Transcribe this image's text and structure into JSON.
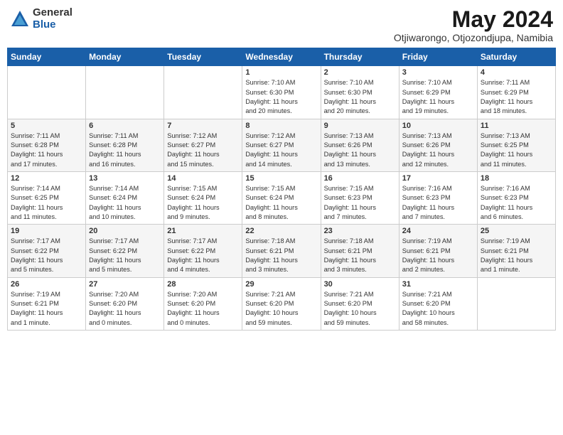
{
  "logo": {
    "general": "General",
    "blue": "Blue"
  },
  "title": {
    "month_year": "May 2024",
    "location": "Otjiwarongo, Otjozondjupa, Namibia"
  },
  "days_header": [
    "Sunday",
    "Monday",
    "Tuesday",
    "Wednesday",
    "Thursday",
    "Friday",
    "Saturday"
  ],
  "weeks": [
    [
      {
        "day": "",
        "info": ""
      },
      {
        "day": "",
        "info": ""
      },
      {
        "day": "",
        "info": ""
      },
      {
        "day": "1",
        "info": "Sunrise: 7:10 AM\nSunset: 6:30 PM\nDaylight: 11 hours\nand 20 minutes."
      },
      {
        "day": "2",
        "info": "Sunrise: 7:10 AM\nSunset: 6:30 PM\nDaylight: 11 hours\nand 20 minutes."
      },
      {
        "day": "3",
        "info": "Sunrise: 7:10 AM\nSunset: 6:29 PM\nDaylight: 11 hours\nand 19 minutes."
      },
      {
        "day": "4",
        "info": "Sunrise: 7:11 AM\nSunset: 6:29 PM\nDaylight: 11 hours\nand 18 minutes."
      }
    ],
    [
      {
        "day": "5",
        "info": "Sunrise: 7:11 AM\nSunset: 6:28 PM\nDaylight: 11 hours\nand 17 minutes."
      },
      {
        "day": "6",
        "info": "Sunrise: 7:11 AM\nSunset: 6:28 PM\nDaylight: 11 hours\nand 16 minutes."
      },
      {
        "day": "7",
        "info": "Sunrise: 7:12 AM\nSunset: 6:27 PM\nDaylight: 11 hours\nand 15 minutes."
      },
      {
        "day": "8",
        "info": "Sunrise: 7:12 AM\nSunset: 6:27 PM\nDaylight: 11 hours\nand 14 minutes."
      },
      {
        "day": "9",
        "info": "Sunrise: 7:13 AM\nSunset: 6:26 PM\nDaylight: 11 hours\nand 13 minutes."
      },
      {
        "day": "10",
        "info": "Sunrise: 7:13 AM\nSunset: 6:26 PM\nDaylight: 11 hours\nand 12 minutes."
      },
      {
        "day": "11",
        "info": "Sunrise: 7:13 AM\nSunset: 6:25 PM\nDaylight: 11 hours\nand 11 minutes."
      }
    ],
    [
      {
        "day": "12",
        "info": "Sunrise: 7:14 AM\nSunset: 6:25 PM\nDaylight: 11 hours\nand 11 minutes."
      },
      {
        "day": "13",
        "info": "Sunrise: 7:14 AM\nSunset: 6:24 PM\nDaylight: 11 hours\nand 10 minutes."
      },
      {
        "day": "14",
        "info": "Sunrise: 7:15 AM\nSunset: 6:24 PM\nDaylight: 11 hours\nand 9 minutes."
      },
      {
        "day": "15",
        "info": "Sunrise: 7:15 AM\nSunset: 6:24 PM\nDaylight: 11 hours\nand 8 minutes."
      },
      {
        "day": "16",
        "info": "Sunrise: 7:15 AM\nSunset: 6:23 PM\nDaylight: 11 hours\nand 7 minutes."
      },
      {
        "day": "17",
        "info": "Sunrise: 7:16 AM\nSunset: 6:23 PM\nDaylight: 11 hours\nand 7 minutes."
      },
      {
        "day": "18",
        "info": "Sunrise: 7:16 AM\nSunset: 6:23 PM\nDaylight: 11 hours\nand 6 minutes."
      }
    ],
    [
      {
        "day": "19",
        "info": "Sunrise: 7:17 AM\nSunset: 6:22 PM\nDaylight: 11 hours\nand 5 minutes."
      },
      {
        "day": "20",
        "info": "Sunrise: 7:17 AM\nSunset: 6:22 PM\nDaylight: 11 hours\nand 5 minutes."
      },
      {
        "day": "21",
        "info": "Sunrise: 7:17 AM\nSunset: 6:22 PM\nDaylight: 11 hours\nand 4 minutes."
      },
      {
        "day": "22",
        "info": "Sunrise: 7:18 AM\nSunset: 6:21 PM\nDaylight: 11 hours\nand 3 minutes."
      },
      {
        "day": "23",
        "info": "Sunrise: 7:18 AM\nSunset: 6:21 PM\nDaylight: 11 hours\nand 3 minutes."
      },
      {
        "day": "24",
        "info": "Sunrise: 7:19 AM\nSunset: 6:21 PM\nDaylight: 11 hours\nand 2 minutes."
      },
      {
        "day": "25",
        "info": "Sunrise: 7:19 AM\nSunset: 6:21 PM\nDaylight: 11 hours\nand 1 minute."
      }
    ],
    [
      {
        "day": "26",
        "info": "Sunrise: 7:19 AM\nSunset: 6:21 PM\nDaylight: 11 hours\nand 1 minute."
      },
      {
        "day": "27",
        "info": "Sunrise: 7:20 AM\nSunset: 6:20 PM\nDaylight: 11 hours\nand 0 minutes."
      },
      {
        "day": "28",
        "info": "Sunrise: 7:20 AM\nSunset: 6:20 PM\nDaylight: 11 hours\nand 0 minutes."
      },
      {
        "day": "29",
        "info": "Sunrise: 7:21 AM\nSunset: 6:20 PM\nDaylight: 10 hours\nand 59 minutes."
      },
      {
        "day": "30",
        "info": "Sunrise: 7:21 AM\nSunset: 6:20 PM\nDaylight: 10 hours\nand 59 minutes."
      },
      {
        "day": "31",
        "info": "Sunrise: 7:21 AM\nSunset: 6:20 PM\nDaylight: 10 hours\nand 58 minutes."
      },
      {
        "day": "",
        "info": ""
      }
    ]
  ]
}
